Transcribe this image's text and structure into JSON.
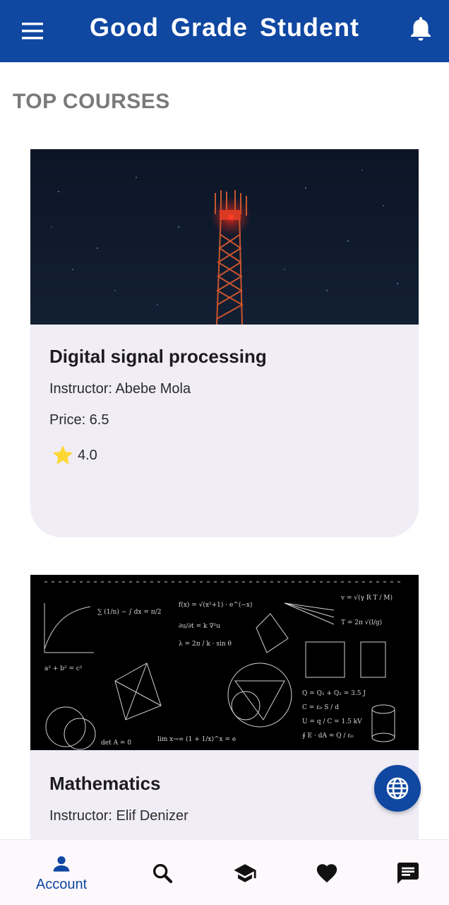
{
  "app": {
    "title": "Good Grade Student"
  },
  "section": {
    "title": "TOP COURSES"
  },
  "courses": [
    {
      "name": "Digital signal processing",
      "instructor": "Instructor: Abebe Mola",
      "price": "Price: 6.5",
      "rating": "4.0",
      "image": "tower-night-image"
    },
    {
      "name": "Mathematics",
      "instructor": "Instructor: Elif Denizer",
      "image": "math-formulas-image"
    }
  ],
  "bottom_nav": {
    "items": [
      {
        "label": "Account",
        "icon": "person-icon",
        "active": true
      },
      {
        "label": "",
        "icon": "search-icon"
      },
      {
        "label": "",
        "icon": "graduation-cap-icon"
      },
      {
        "label": "",
        "icon": "heart-icon"
      },
      {
        "label": "",
        "icon": "chat-icon"
      }
    ]
  },
  "colors": {
    "primary": "#0f47a1",
    "card_bg": "#f0edf7",
    "star": "#fdd835",
    "section_title": "#7a7a7a"
  }
}
